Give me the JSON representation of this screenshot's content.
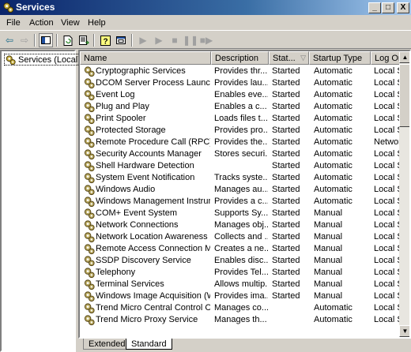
{
  "window": {
    "title": "Services",
    "controls": [
      "_",
      "□",
      "X"
    ]
  },
  "menu": [
    "File",
    "Action",
    "View",
    "Help"
  ],
  "tree": {
    "root": "Services (Local)"
  },
  "columns": [
    "Name",
    "Description",
    "Stat...",
    "Startup Type",
    "Log On"
  ],
  "services": [
    {
      "name": "Cryptographic Services",
      "desc": "Provides thr...",
      "status": "Started",
      "startup": "Automatic",
      "logon": "Local S"
    },
    {
      "name": "DCOM Server Process Launcher",
      "desc": "Provides lau...",
      "status": "Started",
      "startup": "Automatic",
      "logon": "Local S"
    },
    {
      "name": "Event Log",
      "desc": "Enables eve...",
      "status": "Started",
      "startup": "Automatic",
      "logon": "Local S"
    },
    {
      "name": "Plug and Play",
      "desc": "Enables a c...",
      "status": "Started",
      "startup": "Automatic",
      "logon": "Local S"
    },
    {
      "name": "Print Spooler",
      "desc": "Loads files t...",
      "status": "Started",
      "startup": "Automatic",
      "logon": "Local S"
    },
    {
      "name": "Protected Storage",
      "desc": "Provides pro...",
      "status": "Started",
      "startup": "Automatic",
      "logon": "Local S"
    },
    {
      "name": "Remote Procedure Call (RPC)",
      "desc": "Provides the...",
      "status": "Started",
      "startup": "Automatic",
      "logon": "Networ"
    },
    {
      "name": "Security Accounts Manager",
      "desc": "Stores securi...",
      "status": "Started",
      "startup": "Automatic",
      "logon": "Local S"
    },
    {
      "name": "Shell Hardware Detection",
      "desc": "",
      "status": "Started",
      "startup": "Automatic",
      "logon": "Local S"
    },
    {
      "name": "System Event Notification",
      "desc": "Tracks syste...",
      "status": "Started",
      "startup": "Automatic",
      "logon": "Local S"
    },
    {
      "name": "Windows Audio",
      "desc": "Manages au...",
      "status": "Started",
      "startup": "Automatic",
      "logon": "Local S"
    },
    {
      "name": "Windows Management Instrume...",
      "desc": "Provides a c...",
      "status": "Started",
      "startup": "Automatic",
      "logon": "Local S"
    },
    {
      "name": "COM+ Event System",
      "desc": "Supports Sy...",
      "status": "Started",
      "startup": "Manual",
      "logon": "Local S"
    },
    {
      "name": "Network Connections",
      "desc": "Manages obj...",
      "status": "Started",
      "startup": "Manual",
      "logon": "Local S"
    },
    {
      "name": "Network Location Awareness (N...",
      "desc": "Collects and ...",
      "status": "Started",
      "startup": "Manual",
      "logon": "Local S"
    },
    {
      "name": "Remote Access Connection Ma...",
      "desc": "Creates a ne...",
      "status": "Started",
      "startup": "Manual",
      "logon": "Local S"
    },
    {
      "name": "SSDP Discovery Service",
      "desc": "Enables disc...",
      "status": "Started",
      "startup": "Manual",
      "logon": "Local S"
    },
    {
      "name": "Telephony",
      "desc": "Provides Tel...",
      "status": "Started",
      "startup": "Manual",
      "logon": "Local S"
    },
    {
      "name": "Terminal Services",
      "desc": "Allows multip...",
      "status": "Started",
      "startup": "Manual",
      "logon": "Local S"
    },
    {
      "name": "Windows Image Acquisition (WIA)",
      "desc": "Provides ima...",
      "status": "Started",
      "startup": "Manual",
      "logon": "Local S"
    },
    {
      "name": "Trend Micro Central Control Com...",
      "desc": "Manages co...",
      "status": "",
      "startup": "Automatic",
      "logon": "Local S"
    },
    {
      "name": "Trend Micro Proxy Service",
      "desc": "Manages th...",
      "status": "",
      "startup": "Automatic",
      "logon": "Local S"
    }
  ],
  "tabs": [
    "Extended",
    "Standard"
  ],
  "colors": {
    "title_start": "#0a246a",
    "title_end": "#a6caf0",
    "face": "#d4d0c8"
  }
}
